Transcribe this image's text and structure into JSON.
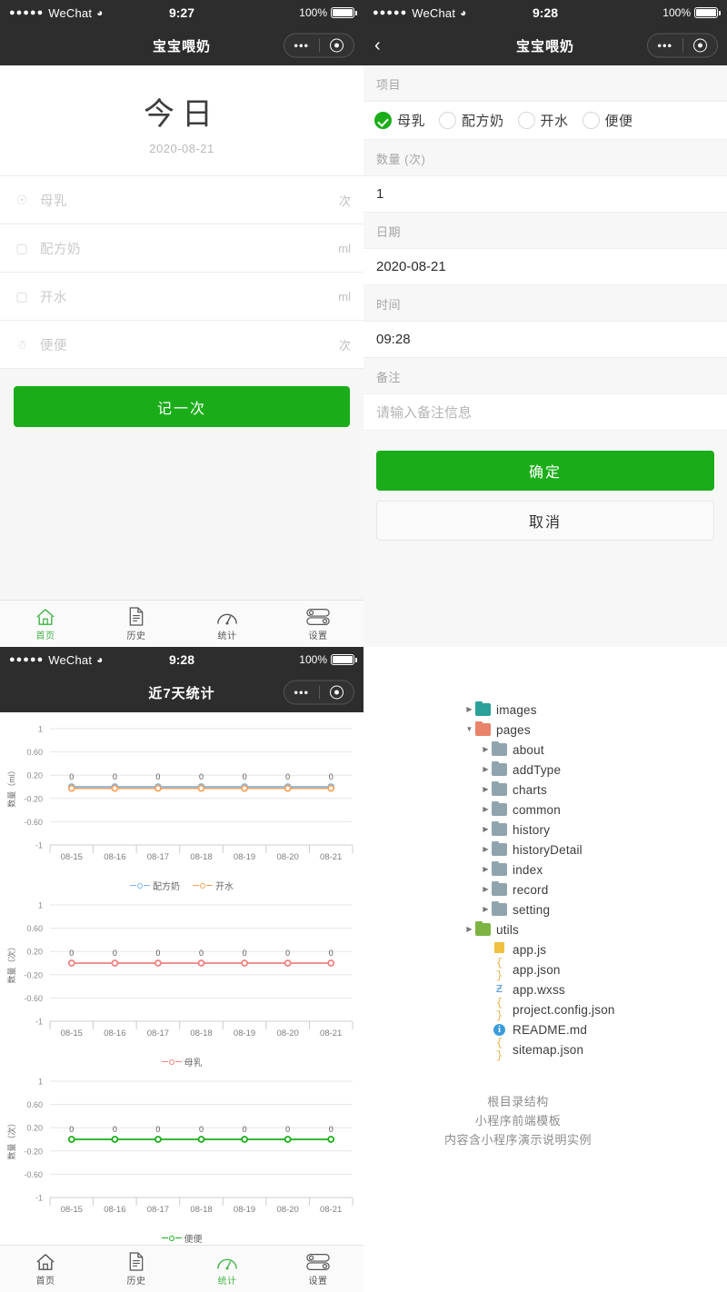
{
  "status_bar": {
    "carrier": "WeChat",
    "dots": "●●●●●",
    "wifi_icon": "wifi-icon",
    "battery_percent": "100%",
    "time_home": "9:27",
    "time_record": "9:28",
    "time_charts": "9:28"
  },
  "capsule": {
    "more_icon": "more-dots-icon",
    "target_icon": "target-circle-icon"
  },
  "home": {
    "nav_title": "宝宝喂奶",
    "hero_title": "今日",
    "hero_date": "2020-08-21",
    "rows": [
      {
        "icon": "breastmilk-icon",
        "label": "母乳",
        "unit": "次"
      },
      {
        "icon": "formula-bottle-icon",
        "label": "配方奶",
        "unit": "ml"
      },
      {
        "icon": "water-icon",
        "label": "开水",
        "unit": "ml"
      },
      {
        "icon": "poop-icon",
        "label": "便便",
        "unit": "次"
      }
    ],
    "record_button": "记一次"
  },
  "tabbar": {
    "tabs": [
      {
        "icon": "home-icon",
        "label": "首页"
      },
      {
        "icon": "history-doc-icon",
        "label": "历史"
      },
      {
        "icon": "stats-gauge-icon",
        "label": "统计"
      },
      {
        "icon": "settings-sliders-icon",
        "label": "设置"
      }
    ],
    "home_active_index": 0,
    "charts_active_index": 2,
    "active_color": "#44b549"
  },
  "record": {
    "nav_title": "宝宝喂奶",
    "back_icon": "chevron-left-icon",
    "group_item_label": "项目",
    "options": [
      {
        "label": "母乳",
        "checked": true
      },
      {
        "label": "配方奶",
        "checked": false
      },
      {
        "label": "开水",
        "checked": false
      },
      {
        "label": "便便",
        "checked": false
      }
    ],
    "group_qty_label": "数量 (次)",
    "qty_value": "1",
    "group_date_label": "日期",
    "date_value": "2020-08-21",
    "group_time_label": "时间",
    "time_value": "09:28",
    "group_note_label": "备注",
    "note_placeholder": "请输入备注信息",
    "confirm_button": "确定",
    "cancel_button": "取消"
  },
  "charts_page": {
    "nav_title": "近7天统计"
  },
  "chart_data": [
    {
      "type": "line",
      "title": "",
      "ylabel": "数量（ml）",
      "x": [
        "08-15",
        "08-16",
        "08-17",
        "08-18",
        "08-19",
        "08-20",
        "08-21"
      ],
      "yticks": [
        "1",
        "0.60",
        "0.20",
        "-0.20",
        "-0.60",
        "-1"
      ],
      "ylim": [
        -1,
        1
      ],
      "grid": true,
      "legend_position": "bottom",
      "point_labels": [
        "0",
        "0",
        "0",
        "0",
        "0",
        "0",
        "0"
      ],
      "series": [
        {
          "name": "配方奶",
          "color": "#7cb5ec",
          "values": [
            0,
            0,
            0,
            0,
            0,
            0,
            0
          ]
        },
        {
          "name": "开水",
          "color": "#f7a35c",
          "values": [
            0,
            0,
            0,
            0,
            0,
            0,
            0
          ]
        }
      ]
    },
    {
      "type": "line",
      "title": "",
      "ylabel": "数量（次）",
      "x": [
        "08-15",
        "08-16",
        "08-17",
        "08-18",
        "08-19",
        "08-20",
        "08-21"
      ],
      "yticks": [
        "1",
        "0.60",
        "0.20",
        "-0.20",
        "-0.60",
        "-1"
      ],
      "ylim": [
        -1,
        1
      ],
      "grid": true,
      "legend_position": "bottom",
      "point_labels": [
        "0",
        "0",
        "0",
        "0",
        "0",
        "0",
        "0"
      ],
      "series": [
        {
          "name": "母乳",
          "color": "#f08080",
          "values": [
            0,
            0,
            0,
            0,
            0,
            0,
            0
          ]
        }
      ]
    },
    {
      "type": "line",
      "title": "",
      "ylabel": "数量（次）",
      "x": [
        "08-15",
        "08-16",
        "08-17",
        "08-18",
        "08-19",
        "08-20",
        "08-21"
      ],
      "yticks": [
        "1",
        "0.60",
        "0.20",
        "-0.20",
        "-0.60",
        "-1"
      ],
      "ylim": [
        -1,
        1
      ],
      "grid": true,
      "legend_position": "bottom",
      "point_labels": [
        "0",
        "0",
        "0",
        "0",
        "0",
        "0",
        "0"
      ],
      "series": [
        {
          "name": "便便",
          "color": "#1aad19",
          "values": [
            0,
            0,
            0,
            0,
            0,
            0,
            0
          ]
        }
      ]
    }
  ],
  "file_tree": {
    "nodes": [
      {
        "name": "images",
        "type": "folder-special",
        "color": "#2aa198",
        "indent": 0,
        "arrow": "collapsed"
      },
      {
        "name": "pages",
        "type": "folder-special",
        "color": "#e8836a",
        "indent": 0,
        "arrow": "expanded"
      },
      {
        "name": "about",
        "type": "folder",
        "color": "#90a4ae",
        "indent": 1,
        "arrow": "collapsed"
      },
      {
        "name": "addType",
        "type": "folder",
        "color": "#90a4ae",
        "indent": 1,
        "arrow": "collapsed"
      },
      {
        "name": "charts",
        "type": "folder",
        "color": "#90a4ae",
        "indent": 1,
        "arrow": "collapsed"
      },
      {
        "name": "common",
        "type": "folder",
        "color": "#90a4ae",
        "indent": 1,
        "arrow": "collapsed"
      },
      {
        "name": "history",
        "type": "folder",
        "color": "#90a4ae",
        "indent": 1,
        "arrow": "collapsed"
      },
      {
        "name": "historyDetail",
        "type": "folder",
        "color": "#90a4ae",
        "indent": 1,
        "arrow": "collapsed"
      },
      {
        "name": "index",
        "type": "folder",
        "color": "#90a4ae",
        "indent": 1,
        "arrow": "collapsed"
      },
      {
        "name": "record",
        "type": "folder",
        "color": "#90a4ae",
        "indent": 1,
        "arrow": "collapsed"
      },
      {
        "name": "setting",
        "type": "folder",
        "color": "#90a4ae",
        "indent": 1,
        "arrow": "collapsed"
      },
      {
        "name": "utils",
        "type": "folder-special",
        "color": "#7cb342",
        "indent": 0,
        "arrow": "collapsed"
      },
      {
        "name": "app.js",
        "type": "js",
        "glyph": "▯",
        "color": "#f0c040",
        "indent": 1,
        "arrow": "none"
      },
      {
        "name": "app.json",
        "type": "json",
        "glyph": "{ }",
        "color": "#e8b44a",
        "indent": 1,
        "arrow": "none"
      },
      {
        "name": "app.wxss",
        "type": "css",
        "glyph": "Ƶ",
        "color": "#4a90d9",
        "indent": 1,
        "arrow": "none"
      },
      {
        "name": "project.config.json",
        "type": "json",
        "glyph": "{ }",
        "color": "#e8b44a",
        "indent": 1,
        "arrow": "none"
      },
      {
        "name": "README.md",
        "type": "info",
        "glyph": "i",
        "color": "#3b9cdb",
        "indent": 1,
        "arrow": "none"
      },
      {
        "name": "sitemap.json",
        "type": "json",
        "glyph": "{ }",
        "color": "#e8b44a",
        "indent": 1,
        "arrow": "none"
      }
    ],
    "note_lines": [
      "根目录结构",
      "小程序前端模板",
      "内容含小程序演示说明实例"
    ]
  }
}
